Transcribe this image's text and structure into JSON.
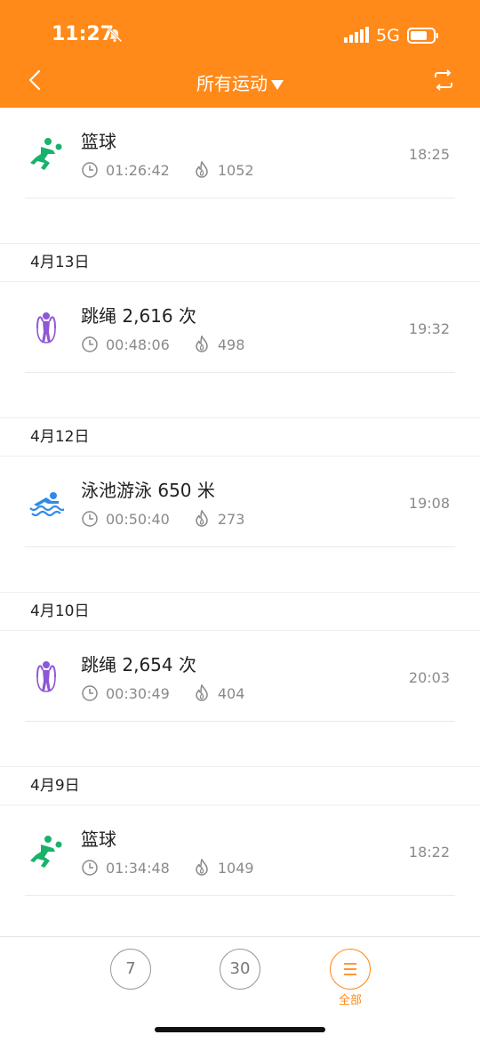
{
  "status": {
    "time": "11:27",
    "network": "5G",
    "bell_icon": "bell-muted-icon",
    "signal_icon": "signal-icon",
    "battery_icon": "battery-icon"
  },
  "nav": {
    "title": "所有运动",
    "back_icon": "chevron-left-icon",
    "switch_icon": "switch-icon"
  },
  "entries": [
    {
      "date": "",
      "activity": "篮球",
      "duration": "01:26:42",
      "calories": "1052",
      "time": "18:25",
      "icon": "basketball-icon"
    },
    {
      "date": "4月13日",
      "activity": "跳绳 2,616 次",
      "duration": "00:48:06",
      "calories": "498",
      "time": "19:32",
      "icon": "jump-rope-icon"
    },
    {
      "date": "4月12日",
      "activity": "泳池游泳 650 米",
      "duration": "00:50:40",
      "calories": "273",
      "time": "19:08",
      "icon": "swim-icon"
    },
    {
      "date": "4月10日",
      "activity": "跳绳 2,654 次",
      "duration": "00:30:49",
      "calories": "404",
      "time": "20:03",
      "icon": "jump-rope-icon"
    },
    {
      "date": "4月9日",
      "activity": "篮球",
      "duration": "01:34:48",
      "calories": "1049",
      "time": "18:22",
      "icon": "basketball-icon"
    }
  ],
  "bottom": {
    "btn7": "7",
    "btn30": "30",
    "all_label": "全部",
    "all_icon": "menu-icon"
  },
  "colors": {
    "accent": "#FF8A1A",
    "basketball": "#19B26B",
    "jump_rope": "#8E57D6",
    "swim": "#2F8BE6"
  }
}
